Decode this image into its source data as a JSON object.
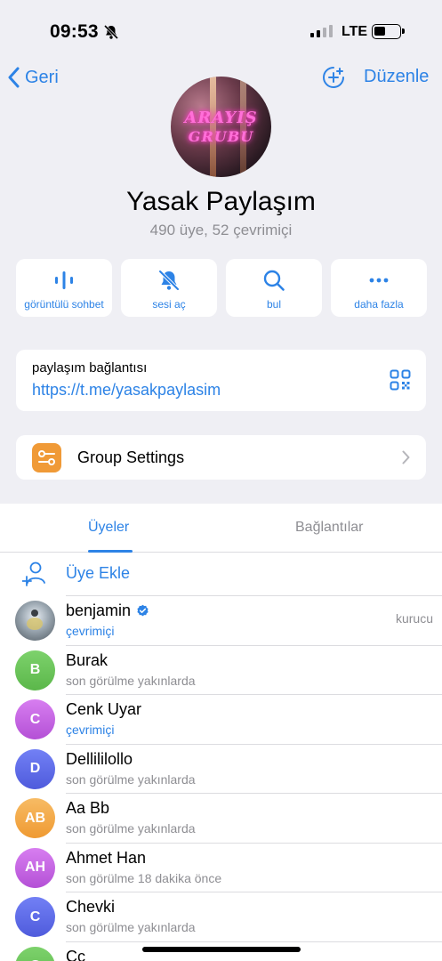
{
  "status_bar": {
    "time": "09:53",
    "network": "LTE",
    "icons": [
      "bell-slash-icon",
      "signal-bars-icon",
      "battery-icon"
    ]
  },
  "nav": {
    "back_label": "Geri",
    "edit_label": "Düzenle",
    "add_icon": "plus-circle-icon"
  },
  "group": {
    "avatar_text_line1": "ARAYIŞ",
    "avatar_text_line2": "GRUBU",
    "name": "Yasak Paylaşım",
    "subtitle": "490 üye, 52 çevrimiçi"
  },
  "actions": [
    {
      "label": "görüntülü sohbet",
      "icon": "voice-chat-icon"
    },
    {
      "label": "sesi aç",
      "icon": "bell-slash-icon"
    },
    {
      "label": "bul",
      "icon": "search-icon"
    },
    {
      "label": "daha fazla",
      "icon": "more-icon"
    }
  ],
  "invite_link": {
    "title": "paylaşım bağlantısı",
    "url": "https://t.me/yasakpaylasim",
    "icon": "qr-code-icon"
  },
  "settings": {
    "label": "Group Settings",
    "icon": "sliders-icon"
  },
  "members_tabs": {
    "active": "Üyeler",
    "inactive": "Bağlantılar"
  },
  "add_member_label": "Üye Ekle",
  "members": [
    {
      "name": "benjamin",
      "status": "çevrimiçi",
      "online": true,
      "role": "kurucu",
      "verified": true,
      "initials": "",
      "color": "#7d8a96"
    },
    {
      "name": "Burak",
      "status": "son görülme yakınlarda",
      "online": false,
      "role": "",
      "verified": false,
      "initials": "B",
      "color": "#69c35a"
    },
    {
      "name": "Cenk Uyar",
      "status": "çevrimiçi",
      "online": true,
      "role": "",
      "verified": false,
      "initials": "C",
      "color": "#c35fe0"
    },
    {
      "name": "Dellililollo",
      "status": "son görülme yakınlarda",
      "online": false,
      "role": "",
      "verified": false,
      "initials": "D",
      "color": "#5b68ec"
    },
    {
      "name": "Aa Bb",
      "status": "son görülme yakınlarda",
      "online": false,
      "role": "",
      "verified": false,
      "initials": "AB",
      "color": "#f2a94a"
    },
    {
      "name": "Ahmet Han",
      "status": "son görülme 18 dakika önce",
      "online": false,
      "role": "",
      "verified": false,
      "initials": "AH",
      "color": "#c35fe0"
    },
    {
      "name": "Chevki",
      "status": "son görülme yakınlarda",
      "online": false,
      "role": "",
      "verified": false,
      "initials": "C",
      "color": "#5b68ec"
    },
    {
      "name": "Cc",
      "status": "",
      "online": false,
      "role": "",
      "verified": false,
      "initials": "C",
      "color": "#69c35a"
    }
  ]
}
